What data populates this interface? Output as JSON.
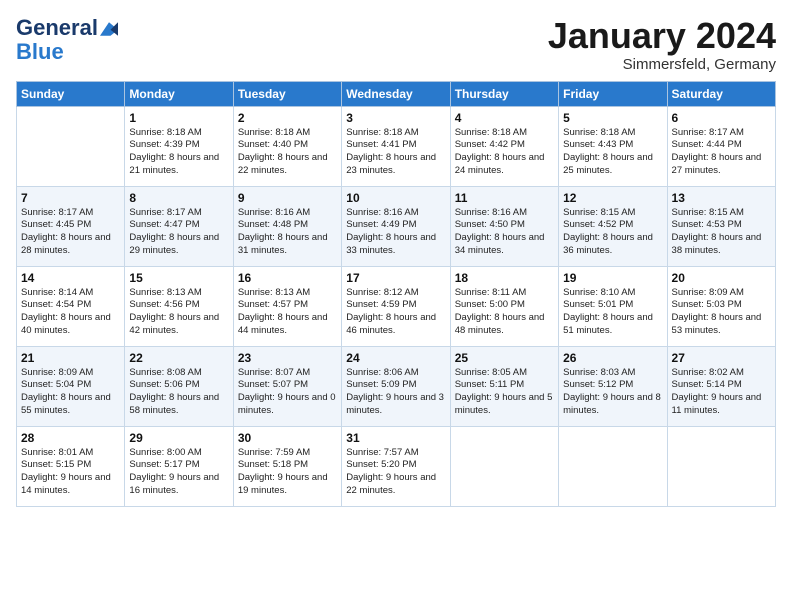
{
  "header": {
    "logo_general": "General",
    "logo_blue": "Blue",
    "month": "January 2024",
    "location": "Simmersfeld, Germany"
  },
  "weekdays": [
    "Sunday",
    "Monday",
    "Tuesday",
    "Wednesday",
    "Thursday",
    "Friday",
    "Saturday"
  ],
  "weeks": [
    [
      {
        "day": "",
        "details": ""
      },
      {
        "day": "1",
        "details": "Sunrise: 8:18 AM\nSunset: 4:39 PM\nDaylight: 8 hours\nand 21 minutes."
      },
      {
        "day": "2",
        "details": "Sunrise: 8:18 AM\nSunset: 4:40 PM\nDaylight: 8 hours\nand 22 minutes."
      },
      {
        "day": "3",
        "details": "Sunrise: 8:18 AM\nSunset: 4:41 PM\nDaylight: 8 hours\nand 23 minutes."
      },
      {
        "day": "4",
        "details": "Sunrise: 8:18 AM\nSunset: 4:42 PM\nDaylight: 8 hours\nand 24 minutes."
      },
      {
        "day": "5",
        "details": "Sunrise: 8:18 AM\nSunset: 4:43 PM\nDaylight: 8 hours\nand 25 minutes."
      },
      {
        "day": "6",
        "details": "Sunrise: 8:17 AM\nSunset: 4:44 PM\nDaylight: 8 hours\nand 27 minutes."
      }
    ],
    [
      {
        "day": "7",
        "details": "Sunrise: 8:17 AM\nSunset: 4:45 PM\nDaylight: 8 hours\nand 28 minutes."
      },
      {
        "day": "8",
        "details": "Sunrise: 8:17 AM\nSunset: 4:47 PM\nDaylight: 8 hours\nand 29 minutes."
      },
      {
        "day": "9",
        "details": "Sunrise: 8:16 AM\nSunset: 4:48 PM\nDaylight: 8 hours\nand 31 minutes."
      },
      {
        "day": "10",
        "details": "Sunrise: 8:16 AM\nSunset: 4:49 PM\nDaylight: 8 hours\nand 33 minutes."
      },
      {
        "day": "11",
        "details": "Sunrise: 8:16 AM\nSunset: 4:50 PM\nDaylight: 8 hours\nand 34 minutes."
      },
      {
        "day": "12",
        "details": "Sunrise: 8:15 AM\nSunset: 4:52 PM\nDaylight: 8 hours\nand 36 minutes."
      },
      {
        "day": "13",
        "details": "Sunrise: 8:15 AM\nSunset: 4:53 PM\nDaylight: 8 hours\nand 38 minutes."
      }
    ],
    [
      {
        "day": "14",
        "details": "Sunrise: 8:14 AM\nSunset: 4:54 PM\nDaylight: 8 hours\nand 40 minutes."
      },
      {
        "day": "15",
        "details": "Sunrise: 8:13 AM\nSunset: 4:56 PM\nDaylight: 8 hours\nand 42 minutes."
      },
      {
        "day": "16",
        "details": "Sunrise: 8:13 AM\nSunset: 4:57 PM\nDaylight: 8 hours\nand 44 minutes."
      },
      {
        "day": "17",
        "details": "Sunrise: 8:12 AM\nSunset: 4:59 PM\nDaylight: 8 hours\nand 46 minutes."
      },
      {
        "day": "18",
        "details": "Sunrise: 8:11 AM\nSunset: 5:00 PM\nDaylight: 8 hours\nand 48 minutes."
      },
      {
        "day": "19",
        "details": "Sunrise: 8:10 AM\nSunset: 5:01 PM\nDaylight: 8 hours\nand 51 minutes."
      },
      {
        "day": "20",
        "details": "Sunrise: 8:09 AM\nSunset: 5:03 PM\nDaylight: 8 hours\nand 53 minutes."
      }
    ],
    [
      {
        "day": "21",
        "details": "Sunrise: 8:09 AM\nSunset: 5:04 PM\nDaylight: 8 hours\nand 55 minutes."
      },
      {
        "day": "22",
        "details": "Sunrise: 8:08 AM\nSunset: 5:06 PM\nDaylight: 8 hours\nand 58 minutes."
      },
      {
        "day": "23",
        "details": "Sunrise: 8:07 AM\nSunset: 5:07 PM\nDaylight: 9 hours\nand 0 minutes."
      },
      {
        "day": "24",
        "details": "Sunrise: 8:06 AM\nSunset: 5:09 PM\nDaylight: 9 hours\nand 3 minutes."
      },
      {
        "day": "25",
        "details": "Sunrise: 8:05 AM\nSunset: 5:11 PM\nDaylight: 9 hours\nand 5 minutes."
      },
      {
        "day": "26",
        "details": "Sunrise: 8:03 AM\nSunset: 5:12 PM\nDaylight: 9 hours\nand 8 minutes."
      },
      {
        "day": "27",
        "details": "Sunrise: 8:02 AM\nSunset: 5:14 PM\nDaylight: 9 hours\nand 11 minutes."
      }
    ],
    [
      {
        "day": "28",
        "details": "Sunrise: 8:01 AM\nSunset: 5:15 PM\nDaylight: 9 hours\nand 14 minutes."
      },
      {
        "day": "29",
        "details": "Sunrise: 8:00 AM\nSunset: 5:17 PM\nDaylight: 9 hours\nand 16 minutes."
      },
      {
        "day": "30",
        "details": "Sunrise: 7:59 AM\nSunset: 5:18 PM\nDaylight: 9 hours\nand 19 minutes."
      },
      {
        "day": "31",
        "details": "Sunrise: 7:57 AM\nSunset: 5:20 PM\nDaylight: 9 hours\nand 22 minutes."
      },
      {
        "day": "",
        "details": ""
      },
      {
        "day": "",
        "details": ""
      },
      {
        "day": "",
        "details": ""
      }
    ]
  ]
}
